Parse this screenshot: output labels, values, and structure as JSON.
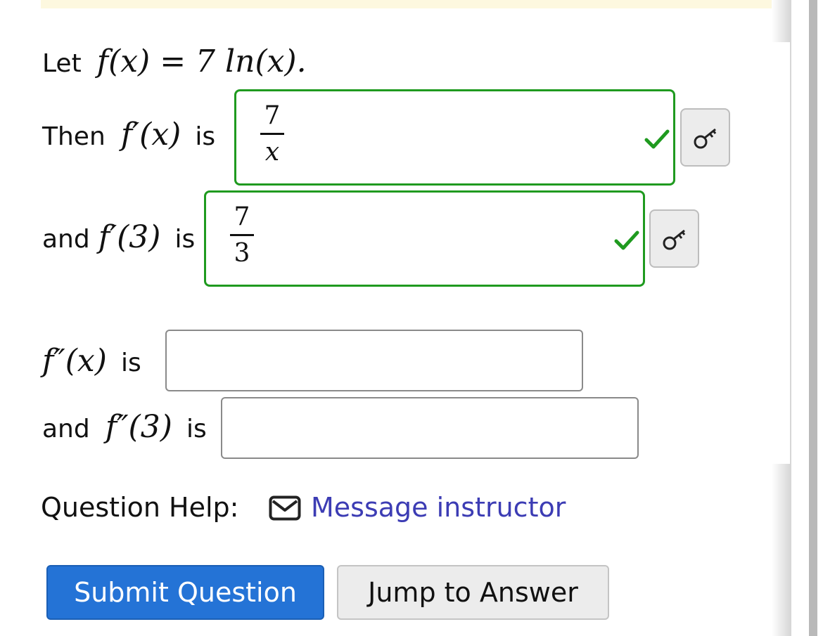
{
  "problem": {
    "let_label": "Let",
    "f_def": "f(x) = 7 ln(x).",
    "q1": {
      "prefix": "Then",
      "expr": "f′(x)",
      "suffix": "is",
      "answer_num": "7",
      "answer_den": "x",
      "status": "correct"
    },
    "q2": {
      "prefix": "and",
      "expr": "f′(3)",
      "suffix": "is",
      "answer_num": "7",
      "answer_den": "3",
      "status": "correct"
    },
    "q3": {
      "expr": "f″(x)",
      "suffix": "is",
      "value": ""
    },
    "q4": {
      "prefix": "and",
      "expr": "f″(3)",
      "suffix": "is",
      "value": ""
    }
  },
  "help": {
    "label": "Question Help:",
    "icon": "envelope-icon",
    "link_text": "Message instructor"
  },
  "buttons": {
    "submit": "Submit Question",
    "jump": "Jump to Answer"
  },
  "colors": {
    "correct": "#1f9a1f",
    "primary": "#2473d6",
    "link": "#3c3cb4",
    "banner": "#fdf8df"
  }
}
